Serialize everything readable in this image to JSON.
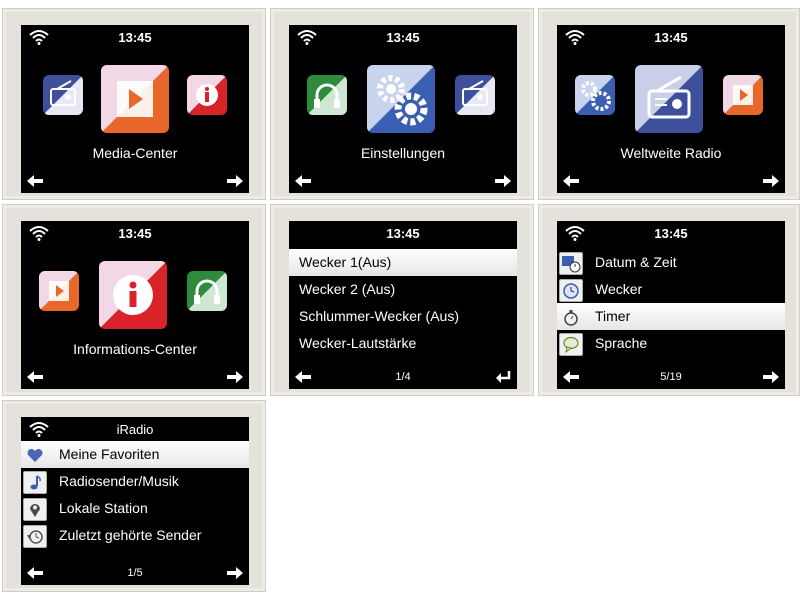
{
  "screens": {
    "media_center": {
      "time": "13:45",
      "label": "Media-Center",
      "tiles": {
        "left": "radio-icon",
        "center": "media-play-icon",
        "right": "info-icon"
      }
    },
    "settings": {
      "time": "13:45",
      "label": "Einstellungen",
      "tiles": {
        "left": "headphones-icon",
        "center": "gears-icon",
        "right": "radio-icon"
      }
    },
    "world_radio": {
      "time": "13:45",
      "label": "Weltweite Radio",
      "tiles": {
        "left": "gears-icon",
        "center": "radio-icon",
        "right": "media-play-icon"
      }
    },
    "info_center": {
      "time": "13:45",
      "label": "Informations-Center",
      "tiles": {
        "left": "media-play-icon",
        "center": "info-icon",
        "right": "headphones-icon"
      }
    },
    "alarm_list": {
      "time": "13:45",
      "items": [
        "Wecker 1(Aus)",
        "Wecker 2 (Aus)",
        "Schlummer-Wecker (Aus)",
        "Wecker-Lautstärke"
      ],
      "selected_index": 0,
      "page": "1/4"
    },
    "settings_list": {
      "time": "13:45",
      "items": [
        {
          "label": "Datum & Zeit",
          "icon": "calendar-clock-icon"
        },
        {
          "label": "Wecker",
          "icon": "alarm-clock-icon"
        },
        {
          "label": "Timer",
          "icon": "stopwatch-icon"
        },
        {
          "label": "Sprache",
          "icon": "speech-bubble-icon"
        }
      ],
      "selected_index": 2,
      "page": "5/19"
    },
    "iradio_list": {
      "title": "iRadio",
      "items": [
        {
          "label": "Meine Favoriten",
          "icon": "heart-icon"
        },
        {
          "label": "Radiosender/Musik",
          "icon": "music-note-icon"
        },
        {
          "label": "Lokale Station",
          "icon": "location-pin-icon"
        },
        {
          "label": "Zuletzt gehörte Sender",
          "icon": "history-icon"
        }
      ],
      "selected_index": 0,
      "page": "1/5"
    }
  },
  "colors": {
    "media_orange": "#e8672a",
    "info_red": "#d8232a",
    "radio_blue": "#3e4f9c",
    "headphones_green": "#2e8b3e",
    "gear_blue": "#3a5fb0",
    "selection_white": "#ffffff"
  }
}
